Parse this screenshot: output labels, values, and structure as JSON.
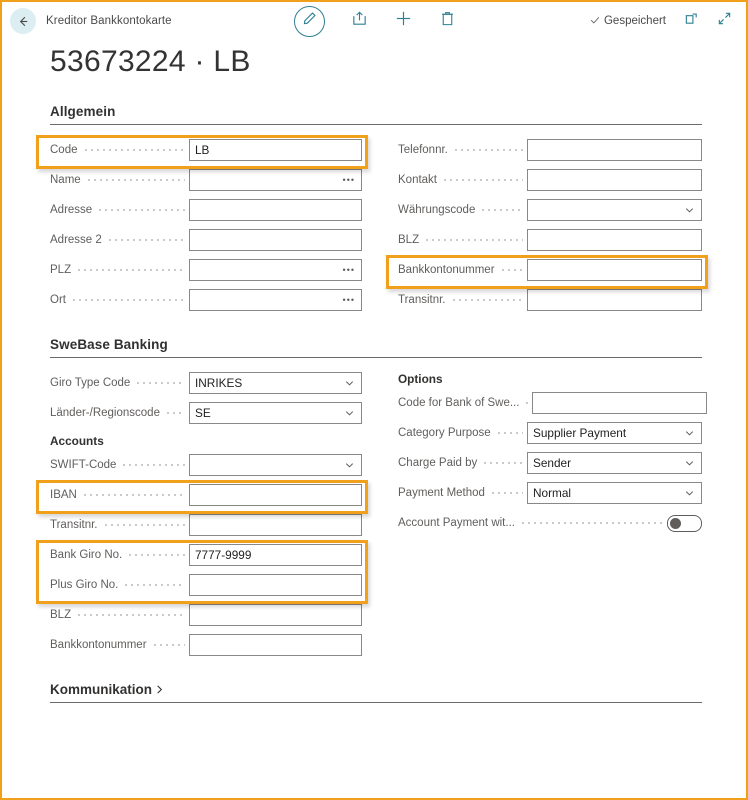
{
  "window": {
    "breadcrumb": "Kreditor Bankkontokarte",
    "record_title": "53673224 · LB",
    "accent_color": "#2E8193",
    "highlight_color": "#F0A01A",
    "back_label": "back-arrow"
  },
  "toolbar": {
    "edit_label": "edit-pencil",
    "share_label": "share",
    "new_label": "new",
    "delete_label": "delete",
    "saved_text": "Gespeichert",
    "open_new_window_label": "open-in-new-window",
    "expand_label": "expand"
  },
  "groups": [
    {
      "id": "allgemein",
      "title": "Allgemein",
      "left_fields": [
        {
          "label": "Code",
          "value": "LB",
          "type": "text",
          "highlighted": true
        },
        {
          "label": "Name",
          "value": "",
          "type": "lookup",
          "highlighted": false
        },
        {
          "label": "Adresse",
          "value": "",
          "type": "text",
          "highlighted": false
        },
        {
          "label": "Adresse 2",
          "value": "",
          "type": "text",
          "highlighted": false
        },
        {
          "label": "PLZ",
          "value": "",
          "type": "lookup",
          "highlighted": false
        },
        {
          "label": "Ort",
          "value": "",
          "type": "lookup",
          "highlighted": false
        }
      ],
      "right_fields": [
        {
          "label": "Telefonnr.",
          "value": "",
          "type": "text",
          "highlighted": false
        },
        {
          "label": "Kontakt",
          "value": "",
          "type": "text",
          "highlighted": false
        },
        {
          "label": "Währungscode",
          "value": "",
          "type": "dropdown",
          "highlighted": false
        },
        {
          "label": "BLZ",
          "value": "",
          "type": "text",
          "highlighted": false
        },
        {
          "label": "Bankkontonummer",
          "value": "",
          "type": "text",
          "highlighted": true
        },
        {
          "label": "Transitnr.",
          "value": "",
          "type": "text",
          "highlighted": false
        }
      ]
    },
    {
      "id": "swebase",
      "title": "SweBase Banking",
      "left_subhead": "Accounts",
      "right_subhead": "Options",
      "left_fields_top": [
        {
          "label": "Giro Type Code",
          "value": "INRIKES",
          "type": "dropdown",
          "highlighted": false
        },
        {
          "label": "Länder-/Regionscode",
          "value": "SE",
          "type": "dropdown",
          "highlighted": false
        }
      ],
      "left_fields_accounts": [
        {
          "label": "SWIFT-Code",
          "value": "",
          "type": "dropdown",
          "highlighted": false
        },
        {
          "label": "IBAN",
          "value": "",
          "type": "text",
          "highlighted": true
        },
        {
          "label": "Transitnr.",
          "value": "",
          "type": "text",
          "highlighted": false
        },
        {
          "label": "Bank Giro No.",
          "value": "7777-9999",
          "type": "text",
          "highlighted": true
        },
        {
          "label": "Plus Giro No.",
          "value": "",
          "type": "text",
          "highlighted": true
        },
        {
          "label": "BLZ",
          "value": "",
          "type": "text",
          "highlighted": false
        },
        {
          "label": "Bankkontonummer",
          "value": "",
          "type": "text",
          "highlighted": false
        }
      ],
      "right_fields_options": [
        {
          "label": "Code for Bank of Swe...",
          "value": "",
          "type": "text",
          "highlighted": false
        },
        {
          "label": "Category Purpose",
          "value": "Supplier Payment",
          "type": "dropdown",
          "highlighted": false
        },
        {
          "label": "Charge Paid by",
          "value": "Sender",
          "type": "dropdown",
          "highlighted": false
        },
        {
          "label": "Payment Method",
          "value": "Normal",
          "type": "dropdown",
          "highlighted": false
        },
        {
          "label": "Account Payment wit...",
          "value": "off",
          "type": "toggle",
          "highlighted": false
        }
      ]
    }
  ],
  "collapsed_section": {
    "title": "Kommunikation"
  }
}
